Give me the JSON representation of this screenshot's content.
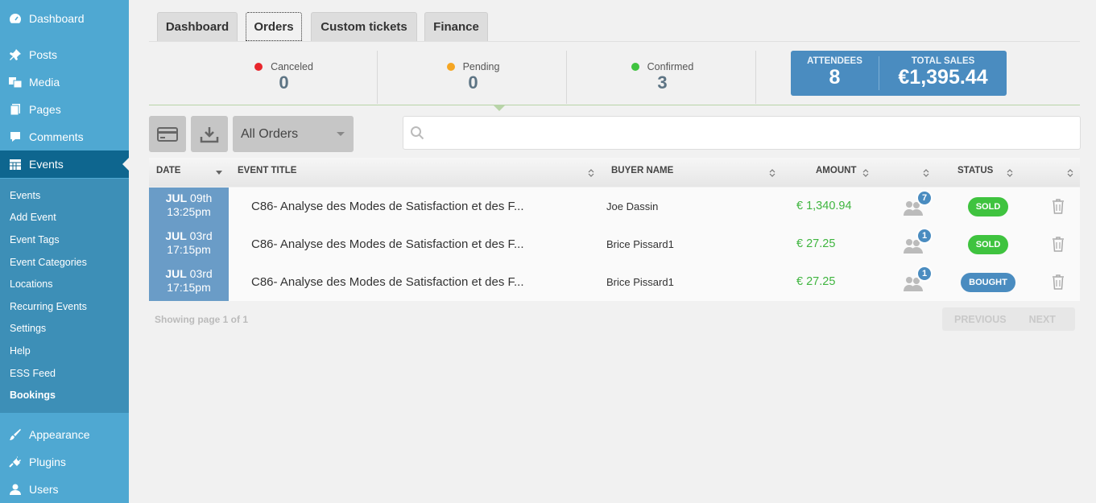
{
  "sidebar": {
    "items_top": [
      {
        "label": "Dashboard",
        "icon": "dashboard-icon"
      },
      {
        "label": "Posts",
        "icon": "pin-icon"
      },
      {
        "label": "Media",
        "icon": "media-icon"
      },
      {
        "label": "Pages",
        "icon": "pages-icon"
      },
      {
        "label": "Comments",
        "icon": "comment-icon"
      },
      {
        "label": "Events",
        "icon": "calendar-icon"
      }
    ],
    "submenu": [
      "Events",
      "Add Event",
      "Event Tags",
      "Event Categories",
      "Locations",
      "Recurring Events",
      "Settings",
      "Help",
      "ESS Feed",
      "Bookings"
    ],
    "items_bottom": [
      {
        "label": "Appearance",
        "icon": "brush-icon"
      },
      {
        "label": "Plugins",
        "icon": "plug-icon"
      },
      {
        "label": "Users",
        "icon": "user-icon"
      }
    ],
    "colors": {
      "bg": "#4fa8d2",
      "active": "#0e668f",
      "submenu_bg": "#3d8fb7"
    }
  },
  "tabs": [
    "Dashboard",
    "Orders",
    "Custom tickets",
    "Finance"
  ],
  "active_tab": "Orders",
  "stats": [
    {
      "label": "Canceled",
      "value": "0",
      "color": "#e8262c"
    },
    {
      "label": "Pending",
      "value": "0",
      "color": "#f5a623"
    },
    {
      "label": "Confirmed",
      "value": "3",
      "color": "#3fc33f"
    }
  ],
  "summary": {
    "attendees_label": "ATTENDEES",
    "attendees_value": "8",
    "sales_label": "TOTAL SALES",
    "sales_value": "€1,395.44"
  },
  "toolbar": {
    "card_icon": "credit-card-icon",
    "download_icon": "download-icon",
    "filter_selected": "All Orders",
    "search_placeholder": ""
  },
  "table": {
    "headers": [
      "DATE",
      "EVENT TITLE",
      "BUYER NAME",
      "AMOUNT",
      "STATUS"
    ],
    "rows": [
      {
        "month": "JUL",
        "day": "09th",
        "time": "13:25pm",
        "title": "C86- Analyse des Modes de Satisfaction et des F...",
        "buyer": "Joe Dassin",
        "amount": "€ 1,340.94",
        "attendees": "7",
        "status": "SOLD"
      },
      {
        "month": "JUL",
        "day": "03rd",
        "time": "17:15pm",
        "title": "C86- Analyse des Modes de Satisfaction et des F...",
        "buyer": "Brice Pissard1",
        "amount": "€ 27.25",
        "attendees": "1",
        "status": "SOLD"
      },
      {
        "month": "JUL",
        "day": "03rd",
        "time": "17:15pm",
        "title": "C86- Analyse des Modes de Satisfaction et des F...",
        "buyer": "Brice Pissard1",
        "amount": "€ 27.25",
        "attendees": "1",
        "status": "BOUGHT"
      }
    ],
    "status_colors": {
      "SOLD": "#3fc33f",
      "BOUGHT": "#4a8cc0"
    }
  },
  "pagination": {
    "info": "Showing page 1 of 1",
    "previous": "PREVIOUS",
    "next": "NEXT"
  }
}
